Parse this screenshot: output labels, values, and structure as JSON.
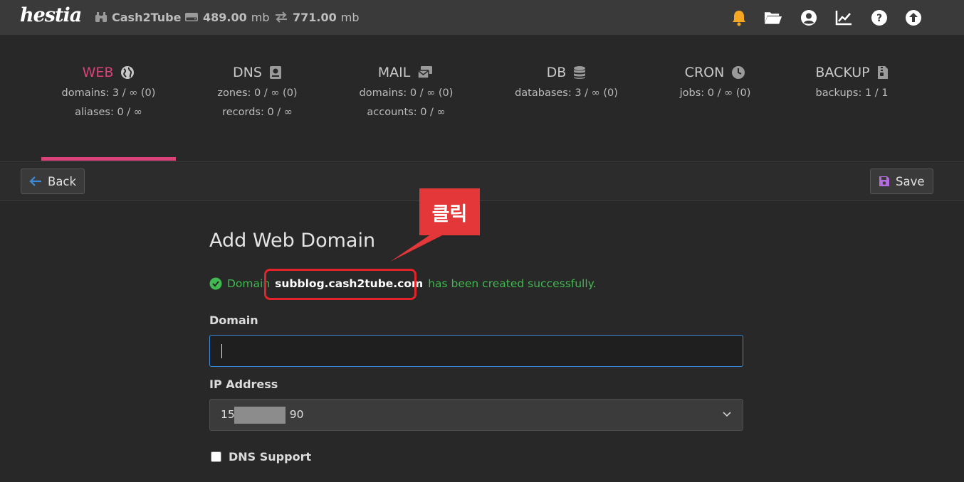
{
  "topbar": {
    "logo": "hestia",
    "user": "Cash2Tube",
    "disk_value": "489.00",
    "disk_unit": "mb",
    "bandwidth_value": "771.00",
    "bandwidth_unit": "mb",
    "icons": [
      "bell-icon",
      "folder-icon",
      "user-icon",
      "chart-icon",
      "help-icon",
      "upload-icon"
    ],
    "bell_color": "#f5a623"
  },
  "stats": [
    {
      "title": "WEB",
      "icon": "globe-icon",
      "lines": [
        "domains: 3 / ∞ (0)",
        "aliases: 0 / ∞"
      ],
      "active": true
    },
    {
      "title": "DNS",
      "icon": "book-icon",
      "lines": [
        "zones: 0 / ∞ (0)",
        "records: 0 / ∞"
      ]
    },
    {
      "title": "MAIL",
      "icon": "mail-icon",
      "lines": [
        "domains: 0 / ∞ (0)",
        "accounts: 0 / ∞"
      ]
    },
    {
      "title": "DB",
      "icon": "database-icon",
      "lines": [
        "databases: 3 / ∞ (0)"
      ]
    },
    {
      "title": "CRON",
      "icon": "clock-icon",
      "lines": [
        "jobs: 0 / ∞ (0)"
      ]
    },
    {
      "title": "BACKUP",
      "icon": "archive-icon",
      "lines": [
        "backups: 1 / 1"
      ]
    }
  ],
  "accent_color": "#d9437a",
  "actions": {
    "back": "Back",
    "save": "Save"
  },
  "form": {
    "title": "Add Web Domain",
    "alert_prefix": "Domain",
    "alert_domain": "subblog.cash2tube.com",
    "alert_suffix": "has been created successfully.",
    "domain_label": "Domain",
    "domain_value": "",
    "ip_label": "IP Address",
    "ip_prefix": "15",
    "ip_suffix": "90",
    "dns_support_label": "DNS Support"
  },
  "annotation": {
    "text": "클릭",
    "color": "#e3373a"
  }
}
